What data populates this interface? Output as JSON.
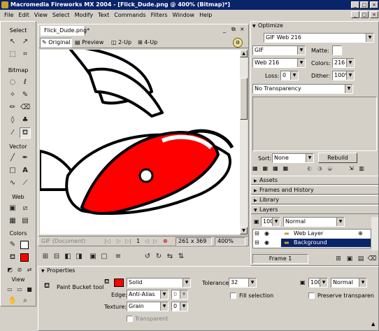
{
  "window": {
    "title": "Macromedia Fireworks MX 2004 - [Flick_Dude.png @ 400% (Bitmap)*]",
    "controls": [
      "_",
      "□",
      "×"
    ],
    "inner_controls": [
      "_",
      "□",
      "×"
    ]
  },
  "menu": [
    "File",
    "Edit",
    "View",
    "Select",
    "Modify",
    "Text",
    "Commands",
    "Filters",
    "Window",
    "Help"
  ],
  "tools": {
    "select_label": "Select",
    "bitmap_label": "Bitmap",
    "vector_label": "Vector",
    "web_label": "Web",
    "colors_label": "Colors",
    "view_label": "View"
  },
  "document": {
    "tab": "Flick_Dude.png*",
    "view_tabs": [
      "Original",
      "Preview",
      "2-Up",
      "4-Up"
    ],
    "status_format": "GIF (Document)",
    "frame": "1",
    "size": "261 x 369",
    "zoom": "400%"
  },
  "optimize": {
    "panel_title": "Optimize",
    "preset": "GIF Web 216",
    "format": "GIF",
    "matte_label": "Matte:",
    "palette": "Web 216",
    "colors_label": "Colors:",
    "colors_value": "216",
    "loss_label": "Loss:",
    "loss_value": "0",
    "dither_label": "Dither:",
    "dither_value": "100%",
    "transparency": "No Transparency",
    "sort_label": "Sort:",
    "sort_value": "None",
    "rebuild": "Rebuild"
  },
  "panels": {
    "assets": "Assets",
    "frames": "Frames and History",
    "library": "Library",
    "layers": "Layers"
  },
  "layers": {
    "opacity": "100",
    "blend": "Normal",
    "items": [
      "Web Layer",
      "Background"
    ],
    "frame_label": "Frame 1"
  },
  "properties": {
    "title": "Properties",
    "tool_name": "Paint Bucket tool",
    "fill_type": "Solid",
    "edge_label": "Edge:",
    "edge_value": "Anti-Alias",
    "edge_amount": "0",
    "texture_label": "Texture:",
    "texture_value": "Grain",
    "texture_amount": "0",
    "transparent": "Transparent",
    "tolerance_label": "Tolerance:",
    "tolerance_value": "32",
    "fill_selection": "Fill selection",
    "opacity": "100",
    "blend": "Normal",
    "preserve": "Preserve transparen",
    "fill_color": "#ff0000"
  }
}
